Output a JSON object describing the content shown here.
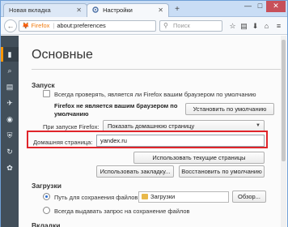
{
  "tabs": [
    {
      "label": "Новая вкладка",
      "active": false
    },
    {
      "label": "Настройки",
      "active": true
    }
  ],
  "window_controls": {
    "minimize": "—",
    "maximize": "□",
    "close": "✕"
  },
  "navbar": {
    "url_badge": "Firefox",
    "url": "about:preferences",
    "search_placeholder": "Поиск",
    "icons": [
      "star-icon",
      "bookmarks-list-icon",
      "download-icon",
      "home-icon",
      "menu-icon"
    ]
  },
  "sidebar": {
    "items": [
      {
        "name": "general",
        "icon": "general-icon",
        "glyph": "▮",
        "active": true
      },
      {
        "name": "search",
        "icon": "search-icon",
        "glyph": "⌕"
      },
      {
        "name": "content",
        "icon": "content-icon",
        "glyph": "▤"
      },
      {
        "name": "applications",
        "icon": "applications-icon",
        "glyph": "✈"
      },
      {
        "name": "privacy",
        "icon": "privacy-icon",
        "glyph": "◉"
      },
      {
        "name": "security",
        "icon": "security-icon",
        "glyph": "⛨"
      },
      {
        "name": "sync",
        "icon": "sync-icon",
        "glyph": "↻"
      },
      {
        "name": "advanced",
        "icon": "advanced-icon",
        "glyph": "✿"
      }
    ]
  },
  "main": {
    "title": "Основные",
    "startup": {
      "section_title": "Запуск",
      "check_default_label": "Всегда проверять, является ли Firefox вашим браузером по умолчанию",
      "not_default_note_line1": "Firefox не является вашим браузером по",
      "not_default_note_line2": "умолчанию",
      "set_default_button": "Установить по умолчанию",
      "on_startup_label": "При запуске Firefox:",
      "on_startup_value": "Показать домашнюю страницу",
      "homepage_label": "Домашняя страница:",
      "homepage_value": "yandex.ru",
      "use_current_button": "Использовать текущие страницы",
      "use_bookmark_button": "Использовать закладку...",
      "restore_default_button": "Восстановить по умолчанию"
    },
    "downloads": {
      "section_title": "Загрузки",
      "save_to_label": "Путь для сохранения файлов",
      "folder_value": "Загрузки",
      "browse_button": "Обзор...",
      "always_ask_label": "Всегда выдавать запрос на сохранение файлов"
    },
    "tabs_section_partial": "Вкладки"
  },
  "colors": {
    "sidebar_bg": "#424f5a",
    "sidebar_active_marker": "#ff9500",
    "highlight_border": "#e0252b",
    "radio_selected": "#2a6ed2"
  }
}
